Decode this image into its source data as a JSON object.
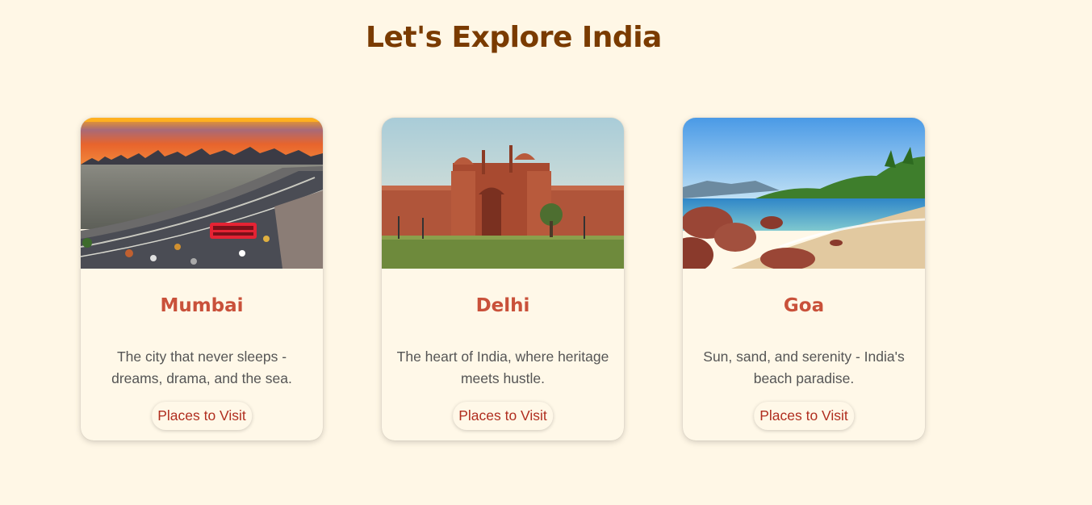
{
  "page": {
    "title": "Let's Explore India"
  },
  "cards": [
    {
      "image_icon": "mumbai-skyline-image",
      "title": "Mumbai",
      "description": "The city that never sleeps - dreams, drama, and the sea.",
      "button_label": "Places to Visit"
    },
    {
      "image_icon": "red-fort-image",
      "title": "Delhi",
      "description": "The heart of India, where heritage meets hustle.",
      "button_label": "Places to Visit"
    },
    {
      "image_icon": "goa-beach-image",
      "title": "Goa",
      "description": "Sun, sand, and serenity - India's beach paradise.",
      "button_label": "Places to Visit"
    }
  ],
  "colors": {
    "background": "#fff7e6",
    "title": "#7a3b00",
    "card_title": "#c9513a",
    "button_text": "#b02e1f"
  }
}
